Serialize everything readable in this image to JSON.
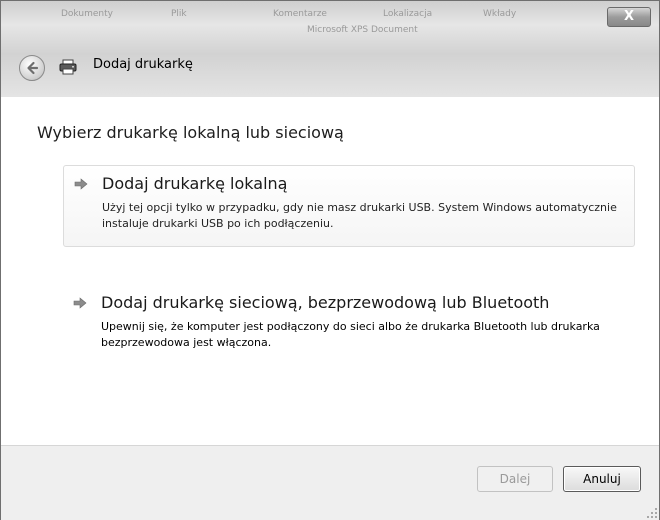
{
  "window": {
    "title": "Dodaj drukarkę",
    "close_label": "X",
    "background_tabs": [
      "Dokumenty",
      "Plik",
      "Komentarze",
      "Lokalizacja",
      "Wkłady"
    ],
    "background_subtitle": "Microsoft XPS Document"
  },
  "content": {
    "heading": "Wybierz drukarkę lokalną lub sieciową",
    "options": [
      {
        "title": "Dodaj drukarkę lokalną",
        "description": "Użyj tej opcji tylko w przypadku, gdy nie masz drukarki USB. System Windows automatycznie instaluje drukarki USB po ich podłączeniu."
      },
      {
        "title": "Dodaj drukarkę sieciową, bezprzewodową lub Bluetooth",
        "description": "Upewnij się, że komputer jest podłączony do sieci albo że drukarka Bluetooth lub drukarka bezprzewodowa jest włączona."
      }
    ]
  },
  "footer": {
    "next_label": "Dalej",
    "next_enabled": false,
    "cancel_label": "Anuluj"
  },
  "icons": {
    "back": "back-arrow-icon",
    "printer": "printer-icon",
    "option_arrow": "green-arrow-icon",
    "close": "close-icon",
    "resize": "resize-grip-icon"
  }
}
